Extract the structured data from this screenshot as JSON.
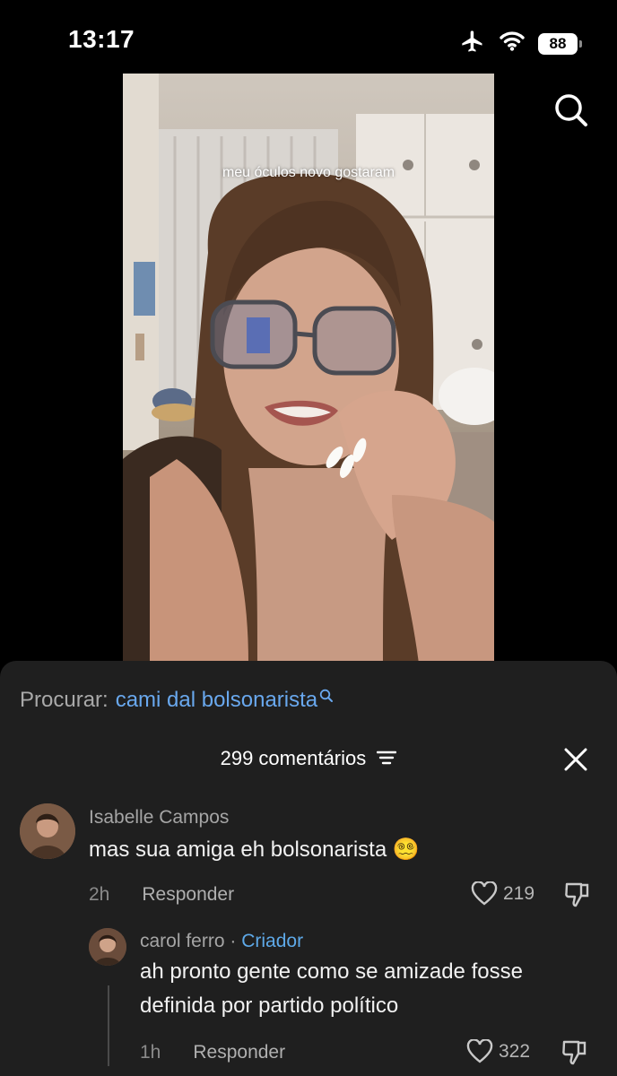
{
  "status_bar": {
    "time": "13:17",
    "battery": "88"
  },
  "video": {
    "caption": "meu óculos novo gostaram"
  },
  "search_suggestion": {
    "prefix": "Procurar:",
    "query": "cami dal bolsonarista"
  },
  "comments": {
    "count_label": "299 comentários",
    "items": [
      {
        "author": "Isabelle Campos",
        "text": "mas sua amiga eh bolsonarista 😵‍💫",
        "time": "2h",
        "reply_label": "Responder",
        "likes": "219"
      },
      {
        "author": "carol ferro",
        "separator": "·",
        "badge": "Criador",
        "text_line1": "ah pronto gente como se amizade fosse",
        "text_line2": "definida por partido político",
        "time": "1h",
        "reply_label": "Responder",
        "likes": "322"
      }
    ]
  }
}
